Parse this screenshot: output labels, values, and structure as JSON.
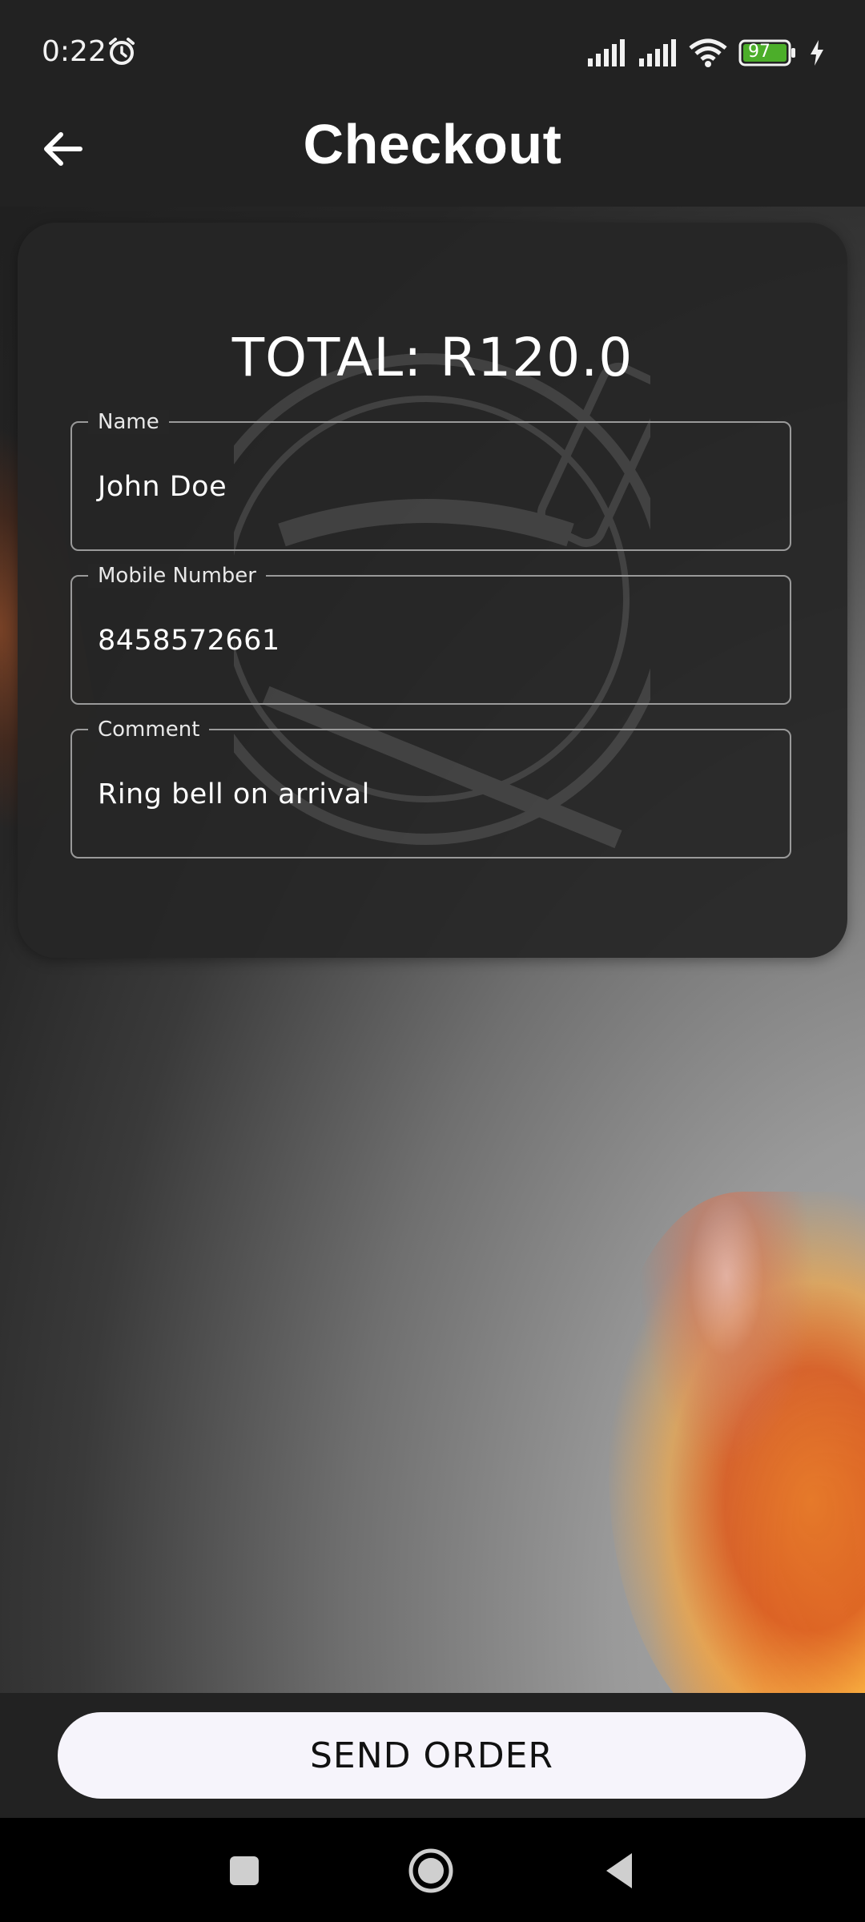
{
  "status_bar": {
    "time": "0:22",
    "battery_level": "97",
    "icons": [
      "alarm-icon",
      "signal-icon",
      "signal-icon",
      "wifi-icon",
      "battery-icon",
      "charging-icon"
    ]
  },
  "app_bar": {
    "title": "Checkout",
    "back_icon": "arrow-left-icon"
  },
  "checkout": {
    "total_label": "TOTAL: R120.0",
    "fields": [
      {
        "label": "Name",
        "value": "John Doe"
      },
      {
        "label": "Mobile Number",
        "value": "8458572661"
      },
      {
        "label": "Comment",
        "value": "Ring bell on arrival"
      }
    ]
  },
  "footer": {
    "send_label": "SEND ORDER"
  },
  "nav_bar": {
    "icons": [
      "recents-square-icon",
      "home-circle-icon",
      "back-triangle-icon"
    ]
  },
  "colors": {
    "background": "#222222",
    "card": "#262626",
    "button": "#f6f4fb",
    "flame": "#e07a2a"
  }
}
